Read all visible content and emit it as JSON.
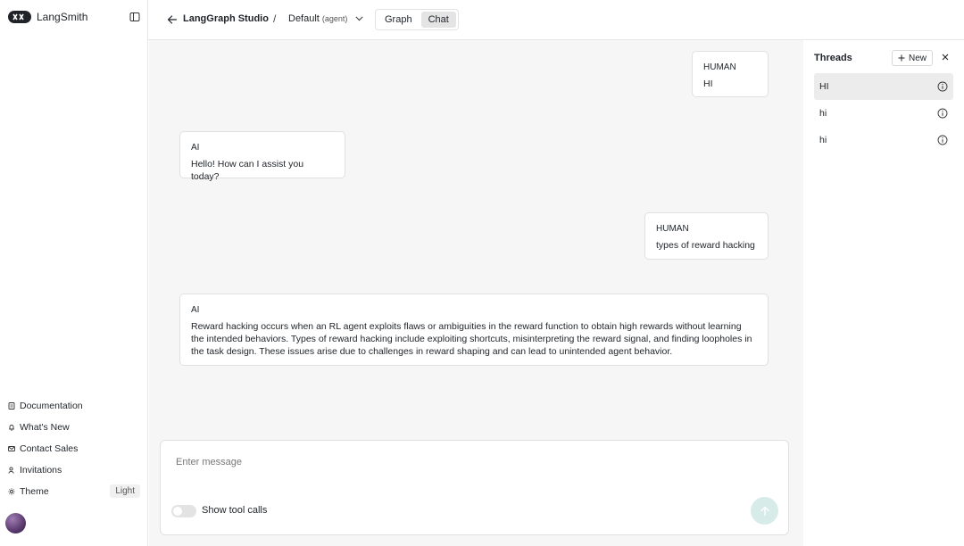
{
  "brand": {
    "name": "LangSmith"
  },
  "sidebar": {
    "items": [
      {
        "label": "Documentation",
        "icon": "document-icon"
      },
      {
        "label": "What's New",
        "icon": "bell-icon"
      },
      {
        "label": "Contact Sales",
        "icon": "mail-icon"
      },
      {
        "label": "Invitations",
        "icon": "user-icon"
      },
      {
        "label": "Theme",
        "icon": "sun-icon",
        "badge": "Light"
      }
    ]
  },
  "header": {
    "title": "LangGraph Studio",
    "separator": "/",
    "assistant": "Default",
    "assistant_sub": "(agent)",
    "tabs": [
      {
        "label": "Graph",
        "active": false
      },
      {
        "label": "Chat",
        "active": true
      }
    ]
  },
  "messages": [
    {
      "role": "HUMAN",
      "text": "HI"
    },
    {
      "role": "AI",
      "text": "Hello! How can I assist you today?"
    },
    {
      "role": "HUMAN",
      "text": "types of reward hacking"
    },
    {
      "role": "AI",
      "text": "Reward hacking occurs when an RL agent exploits flaws or ambiguities in the reward function to obtain high rewards without learning the intended behaviors. Types of reward hacking include exploiting shortcuts, misinterpreting the reward signal, and finding loopholes in the task design. These issues arise due to challenges in reward shaping and can lead to unintended agent behavior."
    }
  ],
  "composer": {
    "placeholder": "Enter message",
    "value": "",
    "toggle_label": "Show tool calls",
    "toggle_on": false
  },
  "threads": {
    "title": "Threads",
    "new_label": "New",
    "items": [
      {
        "label": "HI",
        "active": true
      },
      {
        "label": "hi",
        "active": false
      },
      {
        "label": "hi",
        "active": false
      }
    ]
  },
  "colors": {
    "accent_send": "#d7ece8",
    "chat_bg": "#f6f6f6"
  }
}
